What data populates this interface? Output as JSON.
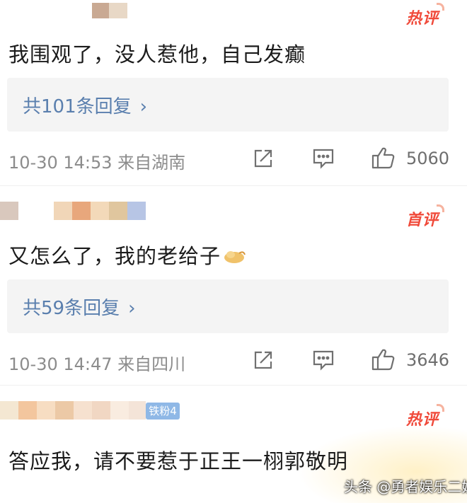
{
  "comments": [
    {
      "badge": "热评",
      "text": "我围观了，没人惹他，自己发癫",
      "reply_label": "共101条回复",
      "reply_chevron": "›",
      "meta": "10-30 14:53 来自湖南",
      "likes": "5060"
    },
    {
      "badge": "首评",
      "text": "又怎么了，我的老给子",
      "reply_label": "共59条回复",
      "reply_chevron": "›",
      "meta": "10-30 14:47 来自四川",
      "likes": "3646"
    },
    {
      "badge": "热评",
      "fan_tag": "铁粉4",
      "text": "答应我，请不要惹于正王一栩郭敬明"
    }
  ],
  "watermark": "头条 @勇者娱乐二姐",
  "colors": {
    "badge": "#f04a3a",
    "reply_link": "#5a7fae",
    "meta": "#8c8c8c"
  },
  "icons": [
    "share-icon",
    "comment-icon",
    "like-icon"
  ]
}
